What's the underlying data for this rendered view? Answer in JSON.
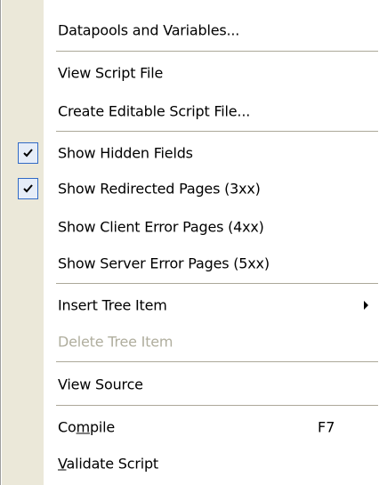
{
  "menu": {
    "items": {
      "datapools": {
        "label": "Datapools and Variables..."
      },
      "view_script": {
        "label": "View Script File"
      },
      "create_editable": {
        "label": "Create Editable Script File..."
      },
      "show_hidden": {
        "label": "Show Hidden Fields",
        "checked": true
      },
      "show_redirected": {
        "label": "Show Redirected Pages (3xx)",
        "checked": true
      },
      "show_client_error": {
        "label": "Show Client Error Pages (4xx)",
        "checked": false
      },
      "show_server_error": {
        "label": "Show Server Error Pages (5xx)",
        "checked": false
      },
      "insert_tree_item": {
        "label": "Insert Tree Item",
        "has_submenu": true
      },
      "delete_tree_item": {
        "label": "Delete Tree Item",
        "disabled": true
      },
      "view_source": {
        "label": "View Source"
      },
      "compile": {
        "label_pre": "Co",
        "label_mnemonic": "m",
        "label_post": "pile",
        "shortcut": "F7"
      },
      "validate_script": {
        "label_mnemonic": "V",
        "label_post": "alidate Script"
      }
    },
    "icons": {
      "check": "checkmark-icon",
      "submenu": "submenu-arrow-icon"
    },
    "colors": {
      "gutter": "#ebe8d9",
      "separator": "#aca899",
      "check_border": "#316ac5",
      "check_fill": "#e6edf8",
      "disabled_text": "#b0ae9e"
    }
  }
}
